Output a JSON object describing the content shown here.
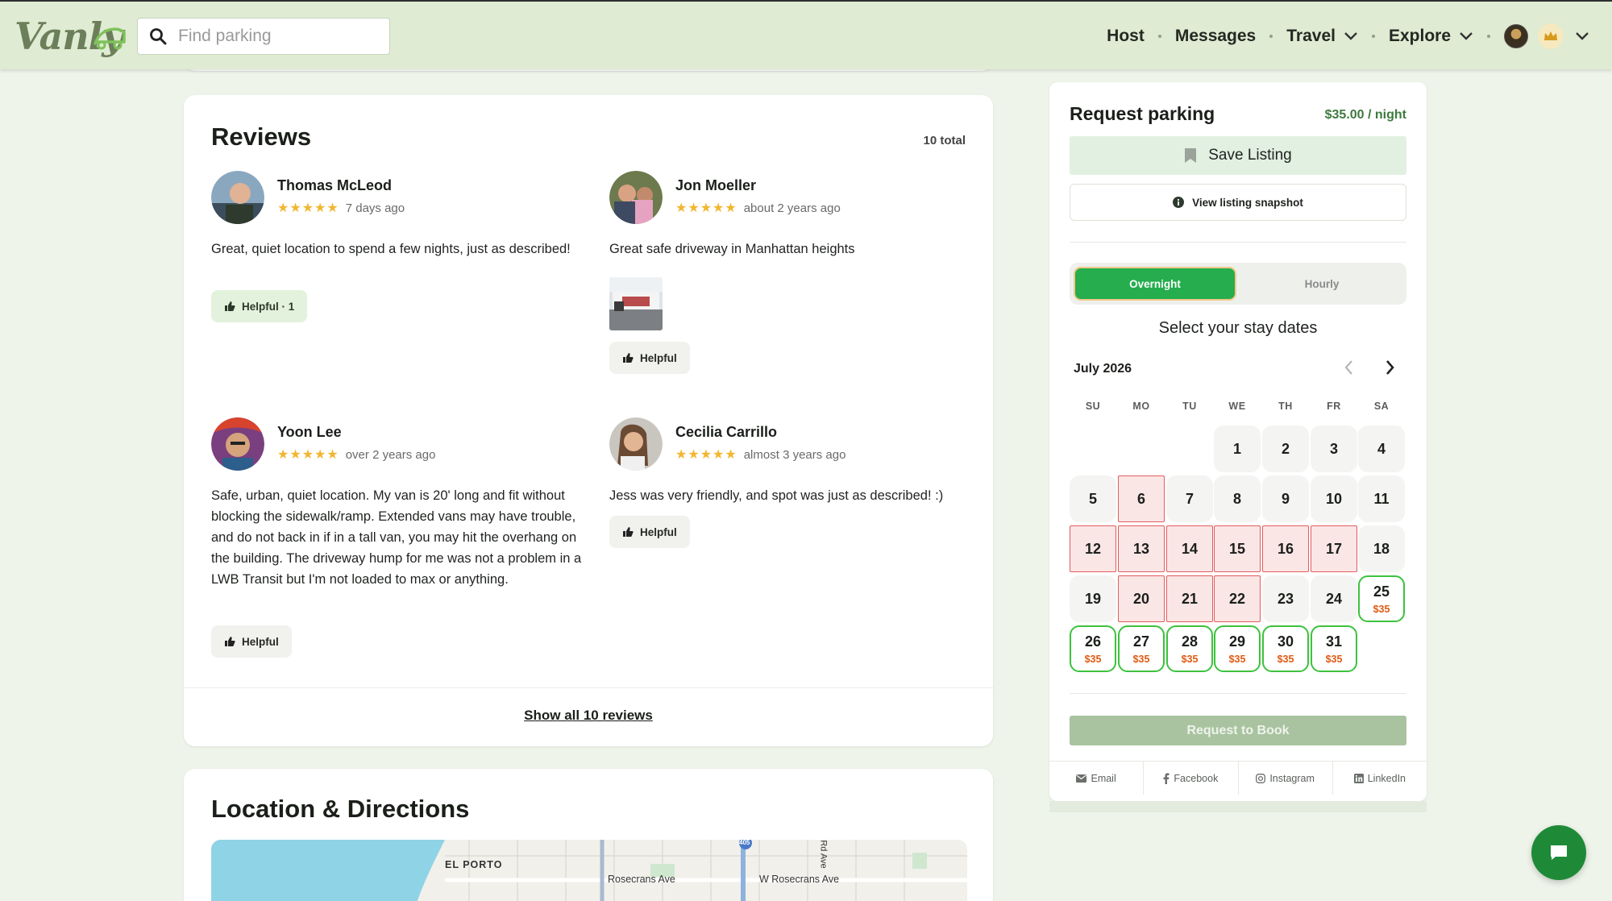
{
  "header": {
    "logo": "Vanly",
    "search_placeholder": "Find parking",
    "nav": {
      "host": "Host",
      "messages": "Messages",
      "travel": "Travel",
      "explore": "Explore"
    }
  },
  "reviews": {
    "title": "Reviews",
    "total": "10 total",
    "items": [
      {
        "name": "Thomas McLeod",
        "stars": "★★★★★",
        "date": "7 days ago",
        "text": "Great, quiet location to spend a few nights, just as described!",
        "helpful": "Helpful · 1"
      },
      {
        "name": "Jon Moeller",
        "stars": "★★★★★",
        "date": "about 2 years ago",
        "text": "Great safe driveway in Manhattan heights",
        "helpful": "Helpful"
      },
      {
        "name": "Yoon Lee",
        "stars": "★★★★★",
        "date": "over 2 years ago",
        "text": "Safe, urban, quiet location. My van is 20' long and fit without blocking the sidewalk/ramp. Extended vans may have trouble, and do not back in if in a tall van, you may hit the overhang on the building. The driveway hump for me was not a problem in a LWB Transit but I'm not loaded to max or anything.",
        "helpful": "Helpful"
      },
      {
        "name": "Cecilia Carrillo",
        "stars": "★★★★★",
        "date": "almost 3 years ago",
        "text": "Jess was very friendly, and spot was just as described! :)",
        "helpful": "Helpful"
      }
    ],
    "show_all": "Show all 10 reviews"
  },
  "location": {
    "title": "Location & Directions",
    "map_labels": {
      "el_porto": "EL PORTO",
      "rosecrans": "Rosecrans Ave",
      "w_rosecrans": "W Rosecrans Ave",
      "rd_ave": "Rd Ave",
      "route": "405"
    }
  },
  "booking": {
    "title": "Request parking",
    "price": "$35.00 / night",
    "save_listing": "Save Listing",
    "view_snapshot": "View listing snapshot",
    "toggle": {
      "overnight": "Overnight",
      "hourly": "Hourly"
    },
    "select_dates": "Select your stay dates",
    "month": "July 2026",
    "weekdays": [
      "SU",
      "MO",
      "TU",
      "WE",
      "TH",
      "FR",
      "SA"
    ],
    "days": {
      "d1": "1",
      "d2": "2",
      "d3": "3",
      "d4": "4",
      "d5": "5",
      "d6": "6",
      "d7": "7",
      "d8": "8",
      "d9": "9",
      "d10": "10",
      "d11": "11",
      "d12": "12",
      "d13": "13",
      "d14": "14",
      "d15": "15",
      "d16": "16",
      "d17": "17",
      "d18": "18",
      "d19": "19",
      "d20": "20",
      "d21": "21",
      "d22": "22",
      "d23": "23",
      "d24": "24",
      "d25": "25",
      "d26": "26",
      "d27": "27",
      "d28": "28",
      "d29": "29",
      "d30": "30",
      "d31": "31"
    },
    "day_price": "$35",
    "request_to_book": "Request to Book",
    "share": {
      "email": "Email",
      "facebook": "Facebook",
      "instagram": "Instagram",
      "linkedin": "LinkedIn"
    }
  },
  "colors": {
    "header_bg": "#dfebd2",
    "accent_green": "#25ad4e",
    "booked_red": "#e25c5c",
    "available_green": "#3cc23d",
    "price_orange": "#e05a12",
    "chat_fab": "#1e8a37"
  },
  "icons": {
    "search": "search-icon",
    "bookmark": "bookmark-icon",
    "info": "info-icon",
    "thumbs_up": "thumbs-up-icon",
    "chat": "chat-icon",
    "crown": "crown-icon"
  }
}
